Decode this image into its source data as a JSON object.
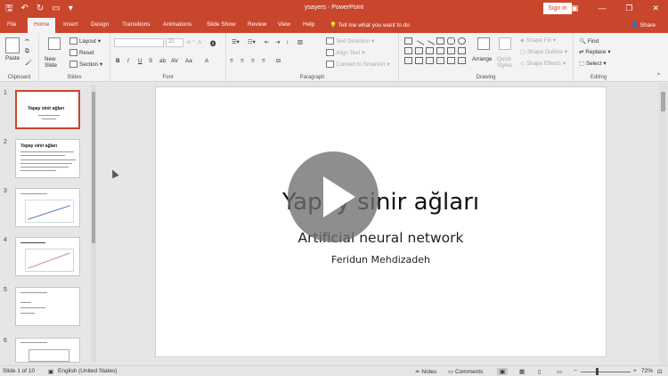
{
  "window": {
    "doc_title": "ysayers - PowerPoint",
    "signin": "Sign in"
  },
  "tabs": [
    "File",
    "Home",
    "Insert",
    "Design",
    "Transitions",
    "Animations",
    "Slide Show",
    "Review",
    "View",
    "Help"
  ],
  "tell_me": "Tell me what you want to do",
  "share": "Share",
  "ribbon": {
    "clipboard": {
      "label": "Clipboard",
      "paste": "Paste"
    },
    "slides": {
      "label": "Slides",
      "new_slide": "New Slide",
      "layout": "Layout",
      "reset": "Reset",
      "section": "Section"
    },
    "font": {
      "label": "Font",
      "size": "32"
    },
    "paragraph": {
      "label": "Paragraph",
      "text_direction": "Text Direction",
      "align_text": "Align Text",
      "convert_smartart": "Convert to SmartArt"
    },
    "drawing": {
      "label": "Drawing",
      "arrange": "Arrange",
      "quick_styles": "Quick Styles",
      "shape_fill": "Shape Fill",
      "shape_outline": "Shape Outline",
      "shape_effects": "Shape Effects"
    },
    "editing": {
      "label": "Editing",
      "find": "Find",
      "replace": "Replace",
      "select": "Select"
    }
  },
  "thumbnails": [
    {
      "num": "1",
      "title": "Yapay sinir ağları"
    },
    {
      "num": "2",
      "title": "Yapay sinir ağları"
    },
    {
      "num": "3",
      "title": ""
    },
    {
      "num": "4",
      "title": ""
    },
    {
      "num": "5",
      "title": ""
    },
    {
      "num": "6",
      "title": ""
    }
  ],
  "slide": {
    "title": "Yapay sinir ağları",
    "subtitle": "Artificial neural network",
    "author": "Feridun Mehdizadeh"
  },
  "status": {
    "slide_info": "Slide 1 of 10",
    "language": "English (United States)",
    "notes": "Notes",
    "comments": "Comments",
    "zoom": "72%"
  },
  "colors": {
    "accent": "#c8462c"
  }
}
